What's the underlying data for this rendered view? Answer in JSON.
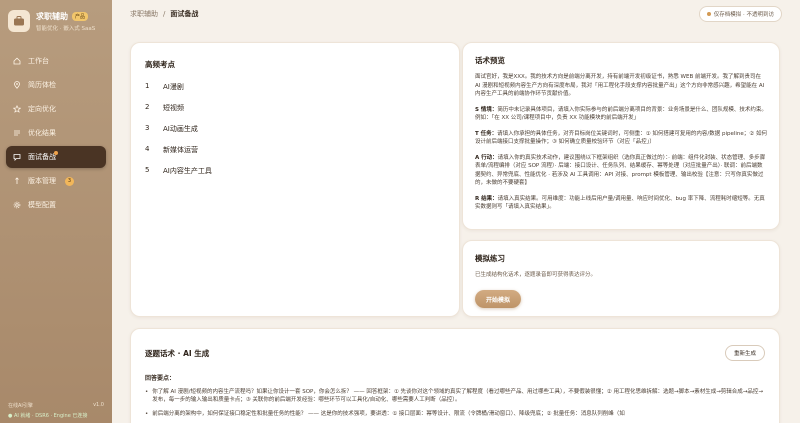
{
  "brand": {
    "title": "求职辅助",
    "badge": "产品",
    "subtitle": "智能优化 · 嵌入式 SaaS"
  },
  "nav": [
    {
      "label": "工作台",
      "icon": "home-icon",
      "active": false
    },
    {
      "label": "简历体检",
      "icon": "location-icon",
      "active": false
    },
    {
      "label": "定向优化",
      "icon": "star-icon",
      "active": false
    },
    {
      "label": "优化结果",
      "icon": "list-icon",
      "active": false
    },
    {
      "label": "面试备战",
      "icon": "chat-icon",
      "active": true
    },
    {
      "label": "版本管理",
      "icon": "version-icon",
      "active": false,
      "count": "3"
    },
    {
      "label": "模型配置",
      "icon": "gear-icon",
      "active": false
    }
  ],
  "footer": {
    "left": "在线AI引擎",
    "version": "v1.0",
    "status": "● AI 就绪 · DSR6 · Engine 已连接"
  },
  "breadcrumb": {
    "root": "求职辅助",
    "sep": "/",
    "current": "面试备战"
  },
  "privacy": "仅存档模拟 · 不透明到访",
  "points": {
    "title": "高频考点",
    "items": [
      "AI漫剧",
      "短视频",
      "AI动画生成",
      "新媒体运营",
      "AI内容生产工具"
    ]
  },
  "script": {
    "title": "话术预览",
    "intro": "面试官好，我是XXX。我的技术方向是前端分离开发，持有前端开发初级证书，熟悉 WEB 前端开发。我了解到贵司在 AI 漫剧和短视频内容生产方向有深度布局，我对「用工程化手段支撑内容批量产出」这个方向非常感兴趣，希望能在 AI 内容生产工具的前端协作环节贡献价值。",
    "s_label": "S 情境：",
    "s_text": "简历中未记录具体项目，请填入你实际参与的前后端分离项目的背景：业务场景是什么、团队规模、技术约束。例如：「在 XX 公司/课程项目中，负责 XX 功能模块的前后端开发」",
    "t_label": "T 任务：",
    "t_text": "请填入你承担的具体任务，对齐目标岗位关键词时，可侧重：① 如何搭建可复用的内容/数据 pipeline；② 如何设计前后端接口支撑批量操作；③ 如何确立质量校验环节（对应「品控」）",
    "a_label": "A 行动：",
    "a_text": "请填入你的真实技术动作，建议围绕以下框架组织（选你真正做过的）：· 前端：组件化封装、状态管理、多步骤表单/流程编排（对应 SOP 流程）· 后端：接口设计、任务队列、结果缓存、幂等处理（对应批量产出）· 联调：前后端数据契约、异常兜底、性能优化 · 若涉及 AI 工具调用：API 对接、prompt 模板管理、输出校验【注意：只写你真实做过的，未做的不要硬套】",
    "r_label": "R 结果：",
    "r_text": "请填入真实结果。可用维度：功能上线后用户量/调用量、响应时间优化、bug 率下降、流程耗时缩短等。无真实数据则写「请填入真实结果」。"
  },
  "practice": {
    "title": "模拟练习",
    "desc": "已生成结构化话术，逐题录音即可获得表达评分。",
    "button": "开始模拟"
  },
  "generated": {
    "title": "逐题话术 · AI 生成",
    "regen": "重新生成",
    "label": "回答要点：",
    "items": [
      "你了解 AI 漫剧/短视频的内容生产流程吗？如果让你设计一套 SOP，你会怎么拆？ —— 回答框架：① 先谈你对这个领域的真实了解程度（看过哪些产品、用过哪些工具），不要假装很懂；② 用工程化思维拆解：选题→脚本→素材生成→剪辑合成→品控→发布，每一步的输入输出和质量卡点；③ 关联你的前后端开发经验：哪些环节可以工具化/自动化、哪些需要人工判断（品控）。",
      "前后端分离的架构中，如何保证接口稳定性和批量任务的性能？ —— 这是你的技术强项，要讲透：① 接口层面：幂等设计、限流（令牌桶/滑动窗口）、降级兜底；② 批量任务：消息队列削峰（如"
    ]
  }
}
